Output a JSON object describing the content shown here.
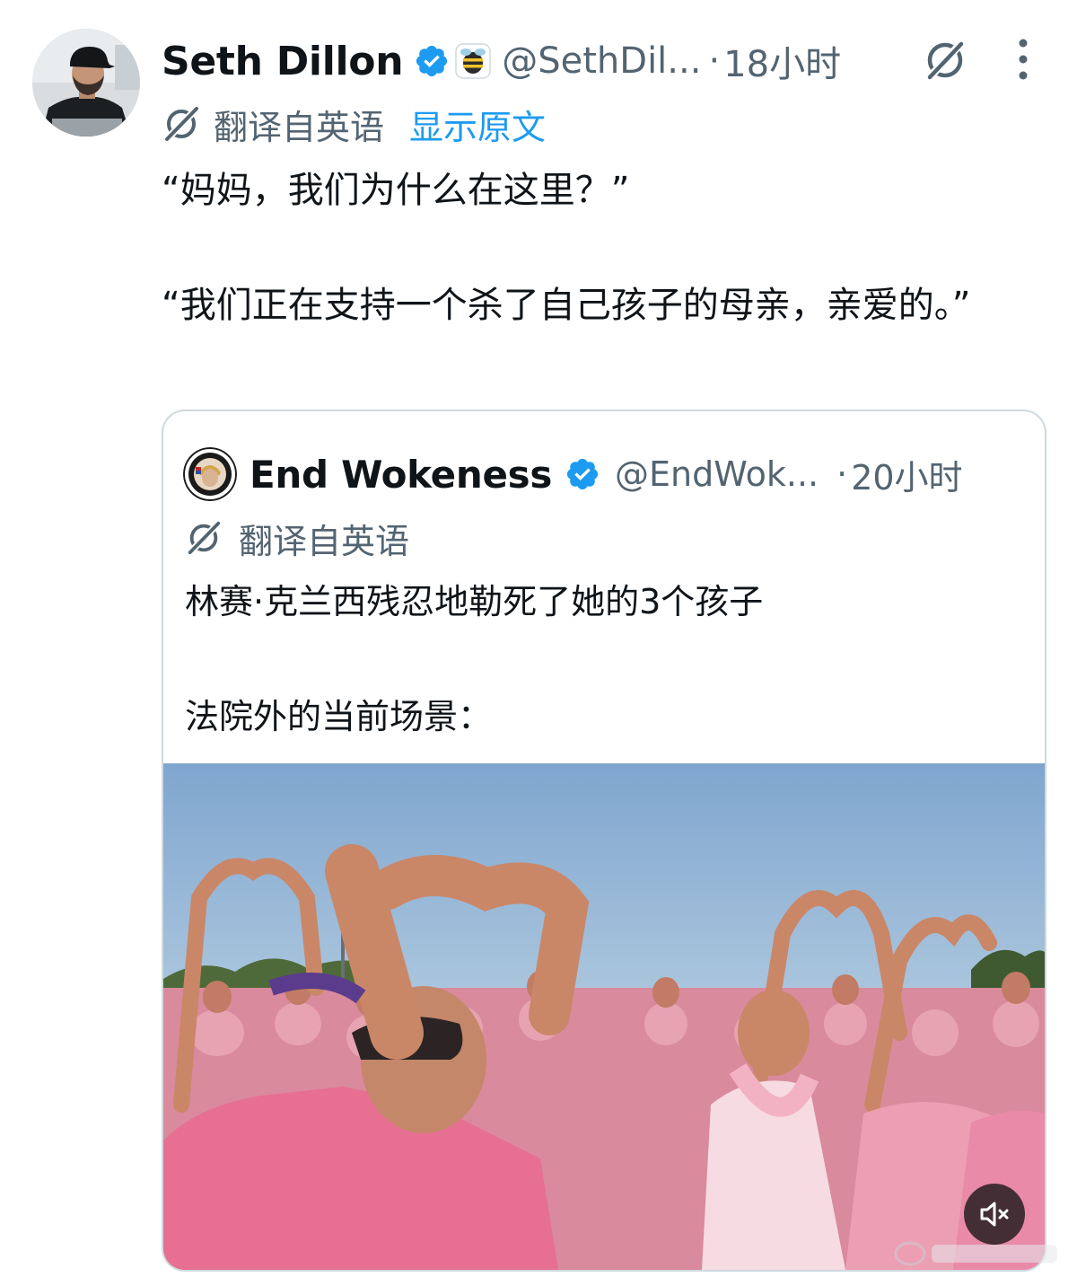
{
  "tweet": {
    "author_name": "Seth Dillon",
    "handle": "@SethDil...",
    "separator": "·",
    "time": "18小时",
    "translated_label": "翻译自英语",
    "show_original": "显示原文",
    "text_line_1": "“妈妈，我们为什么在这里？”",
    "text_line_2": "“我们正在支持一个杀了自己孩子的母亲，亲爱的。”"
  },
  "quoted_tweet": {
    "author_name": "End Wokeness",
    "handle": "@EndWok...",
    "separator": "·",
    "time": "20小时",
    "translated_label": "翻译自英语",
    "text_line_1": "林赛·克兰西残忍地勒死了她的3个孩子",
    "text_line_2": "法院外的当前场景："
  },
  "icons": {
    "verified": "verified-badge-icon",
    "affiliate": "bee-badge-icon",
    "grok": "grok-icon",
    "more": "more-vertical-icon",
    "translate": "translate-icon",
    "mute": "volume-muted-icon"
  },
  "colors": {
    "text_primary": "#0f1419",
    "text_secondary": "#536471",
    "link": "#1d9bf0",
    "verified": "#1d9bf0",
    "card_border": "#cfd9de"
  }
}
